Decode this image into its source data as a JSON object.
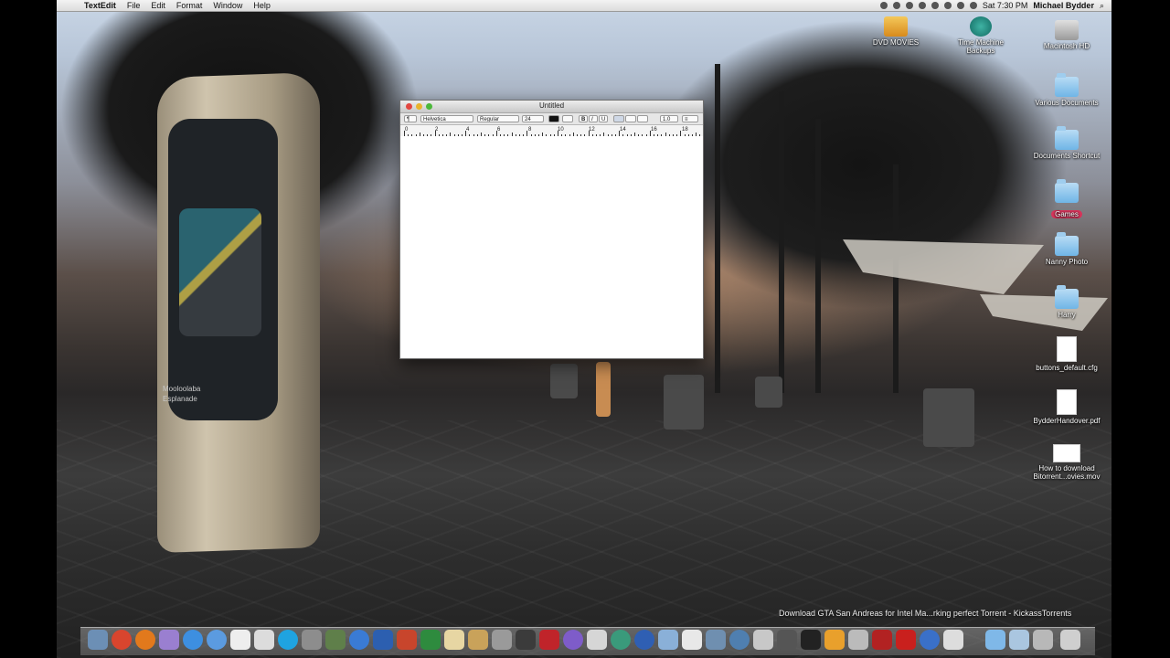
{
  "menubar": {
    "app_name": "TextEdit",
    "items": [
      "File",
      "Edit",
      "Format",
      "Window",
      "Help"
    ],
    "clock": "Sat 7:30 PM",
    "user": "Michael Bydder"
  },
  "desktop_icons": [
    {
      "label": "DVD MOVIES"
    },
    {
      "label": "Time Machine Backups"
    },
    {
      "label": "Macintosh HD"
    },
    {
      "label": "Various Documents"
    },
    {
      "label": "Documents Shortcut"
    },
    {
      "label": "Games"
    },
    {
      "label": "Nanny Photo"
    },
    {
      "label": "Harry"
    },
    {
      "label": "buttons_default.cfg"
    },
    {
      "label": "BydderHandover.pdf"
    },
    {
      "label": "How to download\nBitorrent...ovies.mov"
    }
  ],
  "window": {
    "title": "Untitled",
    "font_family": "Helvetica",
    "font_style": "Regular",
    "font_size": "24",
    "bold": "B",
    "italic": "I",
    "underline": "U",
    "line_spacing": "1.0",
    "list": "≡",
    "ruler_numbers": [
      "0",
      "2",
      "4",
      "6",
      "8",
      "10",
      "12",
      "14",
      "16",
      "18"
    ]
  },
  "sign": {
    "text": "Mooloolaba\nEsplanade"
  },
  "notification": {
    "text": "Download GTA San Andreas for Intel Ma...rking perfect Torrent - KickassTorrents"
  },
  "colors": {
    "close": "#e2463f",
    "minimize": "#e9b32c",
    "zoom": "#4bb83a",
    "games_tag": "#d6345a"
  }
}
